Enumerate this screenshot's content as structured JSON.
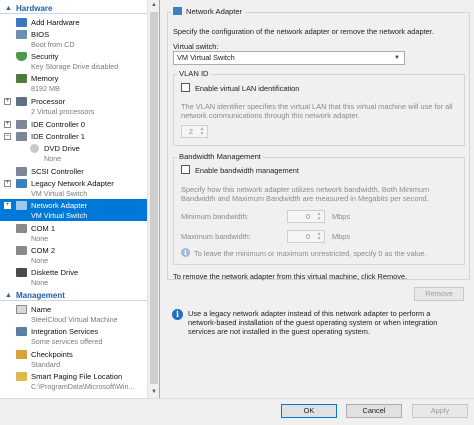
{
  "sidebar": {
    "hardware_header": "Hardware",
    "management_header": "Management",
    "hardware_items": [
      {
        "label": "Add Hardware",
        "sub": ""
      },
      {
        "label": "BIOS",
        "sub": "Boot from CD"
      },
      {
        "label": "Security",
        "sub": "Key Storage Drive disabled"
      },
      {
        "label": "Memory",
        "sub": "8192 MB"
      },
      {
        "label": "Processor",
        "sub": "2 Virtual processors"
      },
      {
        "label": "IDE Controller 0",
        "sub": ""
      },
      {
        "label": "IDE Controller 1",
        "sub": ""
      },
      {
        "label": "DVD Drive",
        "sub": "None"
      },
      {
        "label": "SCSI Controller",
        "sub": ""
      },
      {
        "label": "Legacy Network Adapter",
        "sub": "VM Virtual Switch"
      },
      {
        "label": "Network Adapter",
        "sub": "VM Virtual Switch"
      },
      {
        "label": "COM 1",
        "sub": "None"
      },
      {
        "label": "COM 2",
        "sub": "None"
      },
      {
        "label": "Diskette Drive",
        "sub": "None"
      }
    ],
    "management_items": [
      {
        "label": "Name",
        "sub": "SteelCloud Virtual Machine"
      },
      {
        "label": "Integration Services",
        "sub": "Some services offered"
      },
      {
        "label": "Checkpoints",
        "sub": "Standard"
      },
      {
        "label": "Smart Paging File Location",
        "sub": "C:\\ProgramData\\Microsoft\\Win..."
      }
    ]
  },
  "main": {
    "title": "Network Adapter",
    "description": "Specify the configuration of the network adapter or remove the network adapter.",
    "virtual_switch_label": "Virtual switch:",
    "virtual_switch_value": "VM Virtual Switch",
    "vlan": {
      "legend": "VLAN ID",
      "enable_label": "Enable virtual LAN identification",
      "help": "The VLAN identifier specifies the virtual LAN that this virtual machine will use for all network communications through this network adapter.",
      "vlan_value": "2"
    },
    "bandwidth": {
      "legend": "Bandwidth Management",
      "enable_label": "Enable bandwidth management",
      "help": "Specify how this network adapter utilizes network bandwidth. Both Minimum Bandwidth and Maximum Bandwidth are measured in Megabits per second.",
      "min_label": "Minimum bandwidth:",
      "min_value": "0",
      "min_unit": "Mbps",
      "max_label": "Maximum bandwidth:",
      "max_value": "0",
      "max_unit": "Mbps",
      "leave_text": "To leave the minimum or maximum unrestricted, specify 0 as the value."
    },
    "remove_text": "To remove the network adapter from this virtual machine, click Remove.",
    "remove_button": "Remove",
    "info_text": "Use a legacy network adapter instead of this network adapter to perform a network-based installation of the guest operating system or when integration services are not installed in the guest operating system."
  },
  "footer": {
    "ok": "OK",
    "cancel": "Cancel",
    "apply": "Apply"
  },
  "colors": {
    "selection": "#0078d7",
    "section_header": "#1f5ea8",
    "info": "#1f6fc5"
  },
  "icons": [
    "chevron-up-icon",
    "add-hardware-icon",
    "chip-icon",
    "shield-icon",
    "memory-icon",
    "processor-icon",
    "controller-icon",
    "dvd-icon",
    "network-adapter-icon",
    "com-port-icon",
    "diskette-icon",
    "name-icon",
    "integration-icon",
    "checkpoint-icon",
    "folder-icon",
    "info-icon"
  ]
}
